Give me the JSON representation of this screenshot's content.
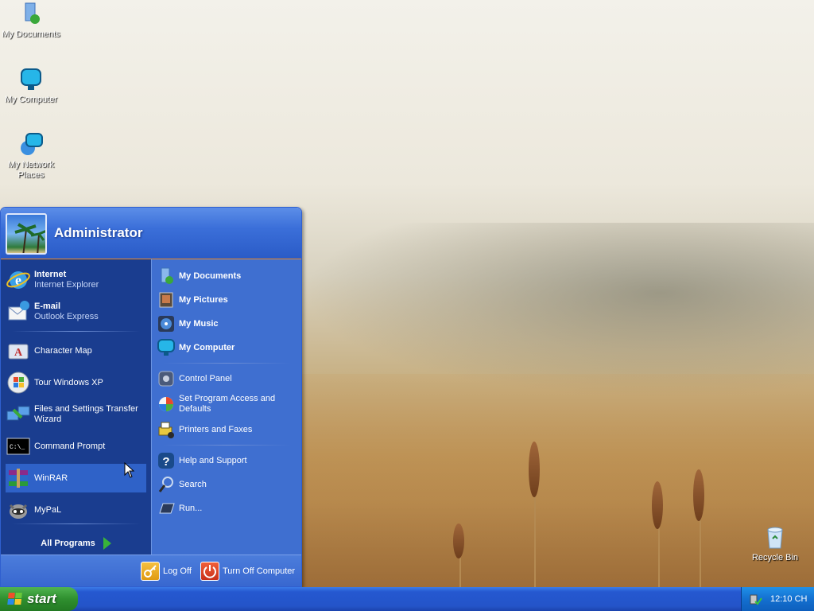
{
  "desktop": {
    "icons": [
      {
        "label": "My Documents",
        "icon": "my-documents-icon"
      },
      {
        "label": "My Computer",
        "icon": "my-computer-icon"
      },
      {
        "label": "My Network Places",
        "icon": "network-places-icon"
      },
      {
        "label": "Recycle Bin",
        "icon": "recycle-bin-icon"
      }
    ]
  },
  "start_menu": {
    "user": "Administrator",
    "left": {
      "pinned": [
        {
          "title": "Internet",
          "subtitle": "Internet Explorer",
          "icon": "internet-explorer-icon"
        },
        {
          "title": "E-mail",
          "subtitle": "Outlook Express",
          "icon": "outlook-express-icon"
        }
      ],
      "recent": [
        {
          "label": "Character Map",
          "icon": "character-map-icon"
        },
        {
          "label": "Tour Windows XP",
          "icon": "tour-windows-icon"
        },
        {
          "label": "Files and Settings Transfer Wizard",
          "icon": "transfer-wizard-icon"
        },
        {
          "label": "Command Prompt",
          "icon": "command-prompt-icon"
        },
        {
          "label": "WinRAR",
          "icon": "winrar-icon"
        },
        {
          "label": "MyPaL",
          "icon": "mypal-icon"
        }
      ],
      "all_programs": "All Programs"
    },
    "right": {
      "places": [
        {
          "label": "My Documents",
          "icon": "my-documents-icon"
        },
        {
          "label": "My Pictures",
          "icon": "my-pictures-icon"
        },
        {
          "label": "My Music",
          "icon": "my-music-icon"
        },
        {
          "label": "My Computer",
          "icon": "my-computer-icon"
        }
      ],
      "settings": [
        {
          "label": "Control Panel",
          "icon": "control-panel-icon"
        },
        {
          "label": "Set Program Access and Defaults",
          "icon": "program-defaults-icon"
        },
        {
          "label": "Printers and Faxes",
          "icon": "printers-icon"
        }
      ],
      "tools": [
        {
          "label": "Help and Support",
          "icon": "help-icon"
        },
        {
          "label": "Search",
          "icon": "search-icon"
        },
        {
          "label": "Run...",
          "icon": "run-icon"
        }
      ]
    },
    "footer": {
      "log_off": "Log Off",
      "turn_off": "Turn Off Computer"
    }
  },
  "taskbar": {
    "start_label": "start",
    "clock": "12:10 CH"
  },
  "colors": {
    "taskbar_blue": "#2454c9",
    "start_green": "#2f8f2f",
    "menu_left": "#1a3d8f",
    "menu_right": "#3f6fd0",
    "menu_accent": "#f08a24"
  }
}
